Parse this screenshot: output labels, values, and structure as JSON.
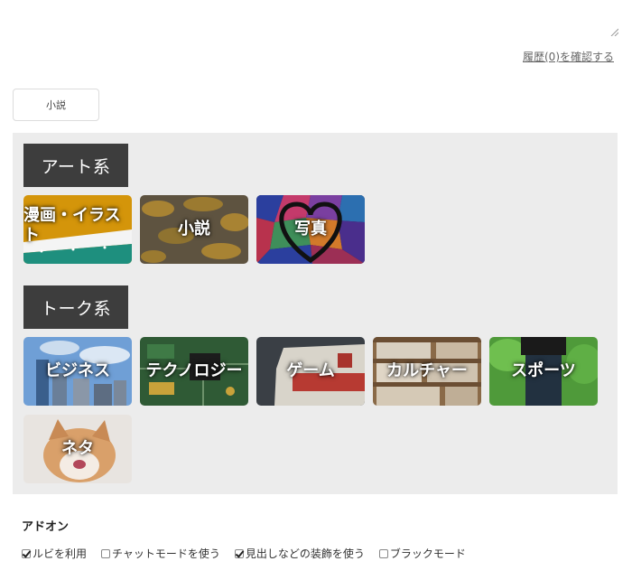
{
  "history_link": "履歴(0)を確認する",
  "selected_category": "小説",
  "groups": [
    {
      "label": "アート系",
      "tiles": [
        "漫画・イラスト",
        "小説",
        "写真"
      ]
    },
    {
      "label": "トーク系",
      "tiles": [
        "ビジネス",
        "テクノロジー",
        "ゲーム",
        "カルチャー",
        "スポーツ",
        "ネタ"
      ]
    }
  ],
  "addons": {
    "title": "アドオン",
    "options": [
      {
        "label": "ルビを利用",
        "checked": true
      },
      {
        "label": "チャットモードを使う",
        "checked": false
      },
      {
        "label": "見出しなどの装飾を使う",
        "checked": true
      },
      {
        "label": "ブラックモード",
        "checked": false
      }
    ]
  }
}
